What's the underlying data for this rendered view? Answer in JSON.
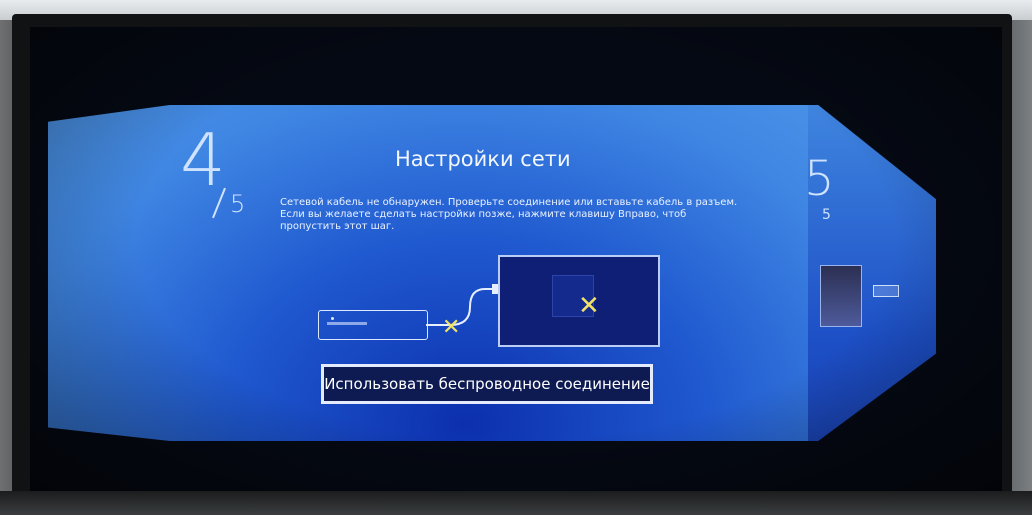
{
  "step": {
    "current": "4",
    "total": "5",
    "title": "Настройки сети",
    "description": "Сетевой кабель не обнаружен. Проверьте соединение или вставьте кабель в разъем. Если вы желаете сделать настройки позже, нажмите клавишу Вправо, чтоб пропустить этот шаг."
  },
  "actions": {
    "wireless_button": "Использовать беспроводное соединение"
  },
  "next_step": {
    "current": "5",
    "total": "5"
  },
  "colors": {
    "panel": "#3f86e3",
    "button_bg": "#0e1a52",
    "error_mark": "#f1e26a"
  },
  "icons": {
    "router": "router-icon",
    "cable": "cable-icon",
    "tv": "tv-icon",
    "error": "x-icon"
  }
}
